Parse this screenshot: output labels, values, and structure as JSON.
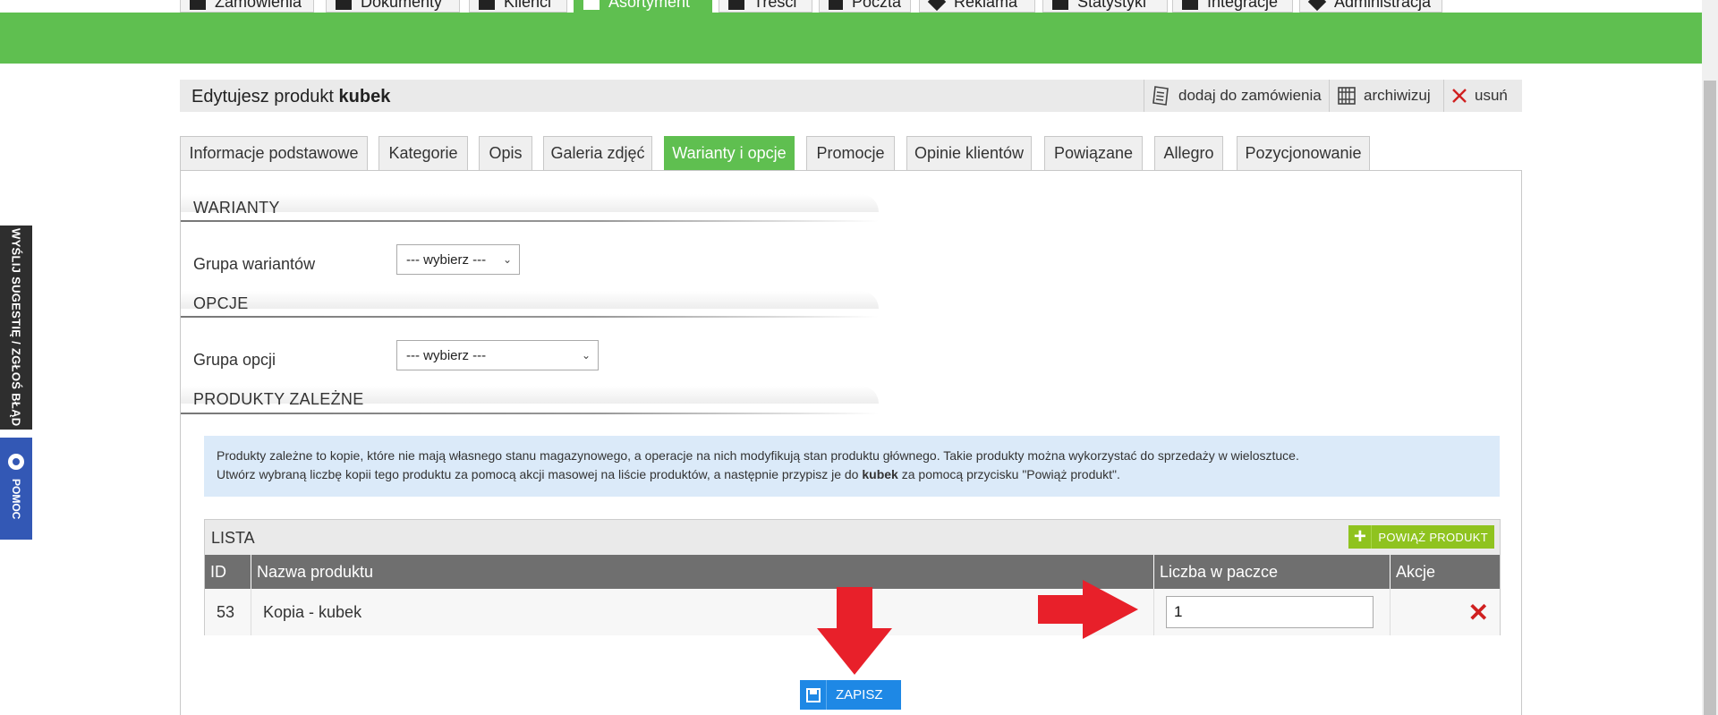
{
  "topnav": {
    "items": [
      {
        "label": "Zamówienia",
        "icon": "cart-icon"
      },
      {
        "label": "Dokumenty",
        "icon": "document-icon"
      },
      {
        "label": "Klienci",
        "icon": "users-icon"
      },
      {
        "label": "Asortyment",
        "icon": "box-icon",
        "active": true
      },
      {
        "label": "Treści",
        "icon": "text-icon"
      },
      {
        "label": "Poczta",
        "icon": "mail-icon"
      },
      {
        "label": "Reklama",
        "icon": "tag-icon"
      },
      {
        "label": "Statystyki",
        "icon": "chart-icon"
      },
      {
        "label": "Integracje",
        "icon": "puzzle-icon"
      },
      {
        "label": "Administracja",
        "icon": "wrench-icon"
      }
    ]
  },
  "sidebar": {
    "feedback_label": "WYŚLIJ SUGESTIĘ / ZGŁOŚ BŁĄD",
    "help_label": "POMOC"
  },
  "header": {
    "title_prefix": "Edytujesz produkt",
    "product_name": "kubek",
    "actions": {
      "add_to_order": "dodaj do zamówienia",
      "archive": "archiwizuj",
      "delete": "usuń"
    }
  },
  "tabs": [
    {
      "label": "Informacje podstawowe"
    },
    {
      "label": "Kategorie"
    },
    {
      "label": "Opis"
    },
    {
      "label": "Galeria zdjęć"
    },
    {
      "label": "Warianty i opcje",
      "active": true
    },
    {
      "label": "Promocje"
    },
    {
      "label": "Opinie klientów"
    },
    {
      "label": "Powiązane"
    },
    {
      "label": "Allegro"
    },
    {
      "label": "Pozycjonowanie"
    }
  ],
  "variants": {
    "section_title": "WARIANTY",
    "group_label": "Grupa wariantów",
    "group_value": "--- wybierz ---"
  },
  "options": {
    "section_title": "OPCJE",
    "group_label": "Grupa opcji",
    "group_value": "--- wybierz ---"
  },
  "dependent": {
    "section_title": "PRODUKTY ZALEŻNE",
    "info_line1": "Produkty zależne to kopie, które nie mają własnego stanu magazynowego, a operacje na nich modyfikują stan produktu głównego. Takie produkty można wykorzystać do sprzedaży w wielosztuce.",
    "info_line2_pre": "Utwórz wybraną liczbę kopii tego produktu za pomocą akcji masowej na liście produktów, a następnie przypisz je do",
    "info_line2_bold": "kubek",
    "info_line2_post": "za pomocą przycisku \"Powiąż produkt\".",
    "list": {
      "title": "LISTA",
      "link_button": "POWIĄŻ PRODUKT",
      "columns": [
        "ID",
        "Nazwa produktu",
        "Liczba w paczce",
        "Akcje"
      ],
      "rows": [
        {
          "id": "53",
          "name": "Kopia - kubek",
          "qty": "1"
        }
      ]
    }
  },
  "save_button": "ZAPISZ",
  "colors": {
    "green": "#5fbf50",
    "blue_save": "#1e88e5",
    "lime_button": "#8fc31f",
    "annotation_red": "#e8202a"
  }
}
